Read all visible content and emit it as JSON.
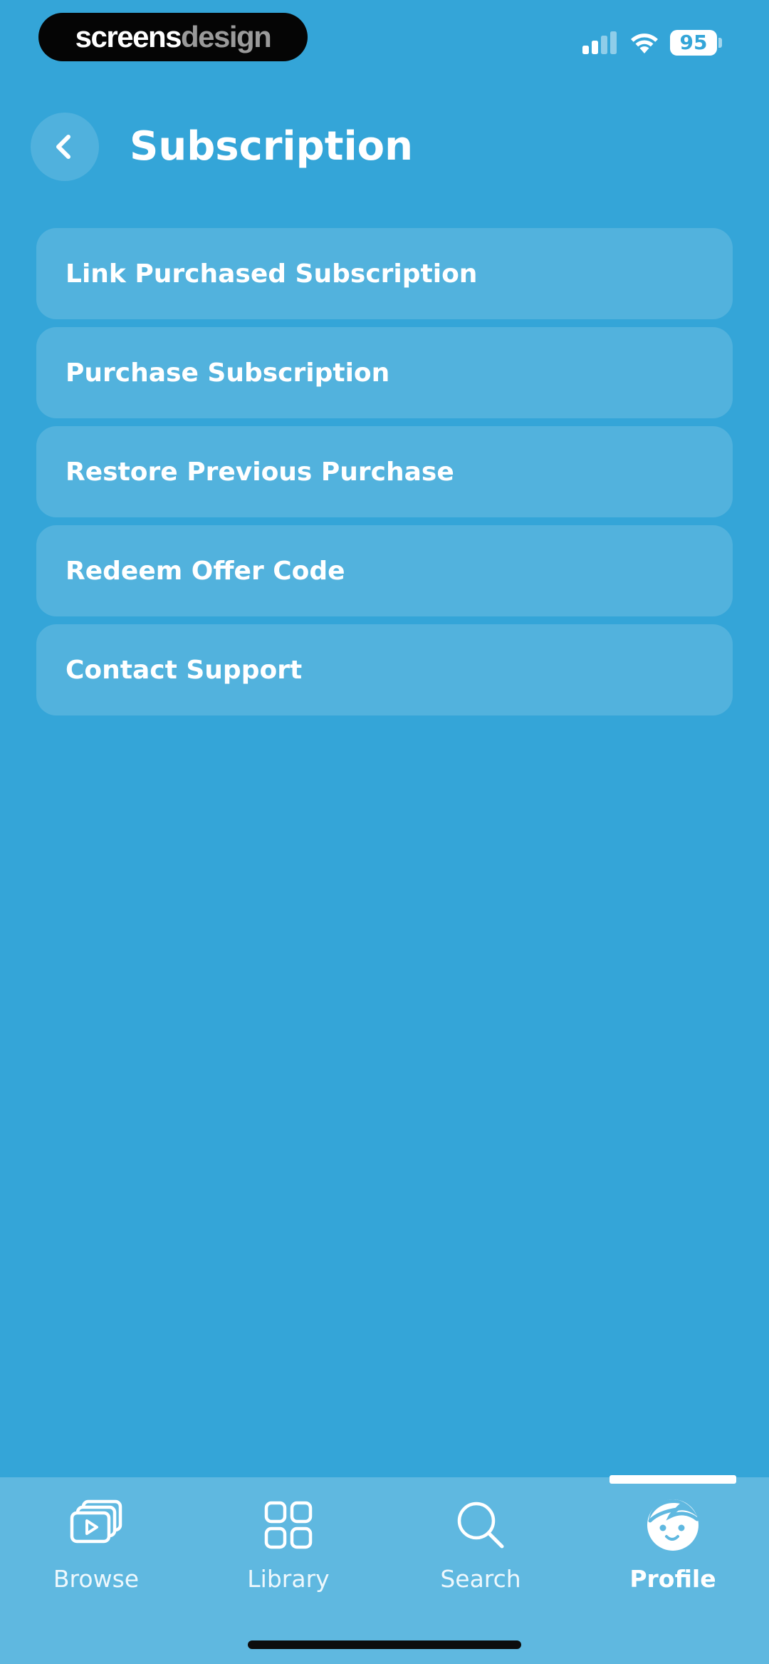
{
  "status_bar": {
    "watermark": {
      "part1": "screens",
      "part2": "design"
    },
    "battery_level": "95",
    "icons": [
      "signal-icon",
      "wifi-icon",
      "battery-icon"
    ]
  },
  "header": {
    "title": "Subscription",
    "back_icon": "chevron-left-icon"
  },
  "menu": {
    "items": [
      {
        "label": "Link Purchased Subscription"
      },
      {
        "label": "Purchase Subscription"
      },
      {
        "label": "Restore Previous Purchase"
      },
      {
        "label": "Redeem Offer Code"
      },
      {
        "label": "Contact Support"
      }
    ]
  },
  "tab_bar": {
    "tabs": [
      {
        "label": "Browse",
        "icon": "play-cards-icon"
      },
      {
        "label": "Library",
        "icon": "grid-icon"
      },
      {
        "label": "Search",
        "icon": "search-icon"
      },
      {
        "label": "Profile",
        "icon": "face-icon"
      }
    ],
    "active": "Profile"
  },
  "colors": {
    "background": "#34a5d8",
    "tab_bar": "#5fb8e0",
    "text": "#ffffff"
  }
}
